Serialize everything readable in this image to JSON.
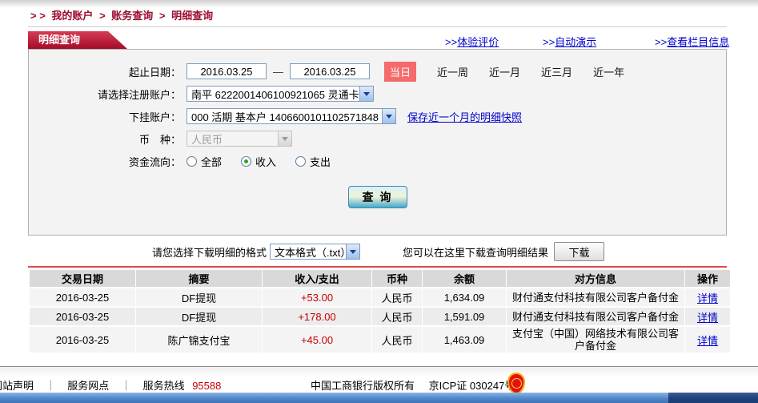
{
  "breadcrumb": {
    "prefix": "> >",
    "separator": ">",
    "items": [
      "我的账户",
      "账务查询",
      "明细查询"
    ]
  },
  "tab": {
    "title": "明细查询"
  },
  "quick_links": [
    {
      "prefix": ">>",
      "label": "体验评价"
    },
    {
      "prefix": ">>",
      "label": "自动演示"
    },
    {
      "prefix": ">>",
      "label": "查看栏目信息"
    }
  ],
  "form": {
    "date_range": {
      "label": "起止日期：",
      "from": "2016.03.25",
      "to": "2016.03.25",
      "separator": "—",
      "presets": [
        {
          "label": "当日",
          "active": true
        },
        {
          "label": "近一周",
          "active": false
        },
        {
          "label": "近一月",
          "active": false
        },
        {
          "label": "近三月",
          "active": false
        },
        {
          "label": "近一年",
          "active": false
        }
      ]
    },
    "register_account": {
      "label": "请选择注册账户：",
      "value": "南平 6222001406100921065 灵通卡"
    },
    "sub_account": {
      "label": "下挂账户：",
      "value": "000 活期 基本户 1406600101102571848",
      "snapshot_link": "保存近一个月的明细快照"
    },
    "currency": {
      "label": "币　种：",
      "value": "人民币",
      "disabled": true
    },
    "fund_flow": {
      "label": "资金流向：",
      "options": [
        {
          "label": "全部",
          "checked": false
        },
        {
          "label": "收入",
          "checked": true
        },
        {
          "label": "支出",
          "checked": false
        }
      ]
    },
    "query_button": "查 询"
  },
  "download": {
    "format_label": "请您选择下载明细的格式",
    "format_value": "文本格式（.txt）",
    "hint": "您可以在这里下载查询明细结果",
    "button": "下载"
  },
  "table": {
    "headers": [
      "交易日期",
      "摘要",
      "收入/支出",
      "币种",
      "余额",
      "对方信息",
      "操作"
    ],
    "rows": [
      {
        "date": "2016-03-25",
        "summary": "DF提现",
        "amount": "+53.00",
        "currency": "人民币",
        "balance": "1,634.09",
        "counterparty": "财付通支付科技有限公司客户备付金",
        "action": "详情"
      },
      {
        "date": "2016-03-25",
        "summary": "DF提现",
        "amount": "+178.00",
        "currency": "人民币",
        "balance": "1,591.09",
        "counterparty": "财付通支付科技有限公司客户备付金",
        "action": "详情"
      },
      {
        "date": "2016-03-25",
        "summary": "陈广锦支付宝",
        "amount": "+45.00",
        "currency": "人民币",
        "balance": "1,463.09",
        "counterparty": "支付宝（中国）网络技术有限公司客户备付金",
        "action": "详情"
      }
    ]
  },
  "footer": {
    "link1": "网站声明",
    "link2": "服务网点",
    "hotline_label": "服务热线",
    "hotline_number": "95588",
    "copyright": "中国工商银行版权所有",
    "icp": "京ICP证 030247号",
    "separator": "｜"
  },
  "colors": {
    "accent_red": "#a30d26",
    "preset_active_bg": "#f56a6a",
    "link_blue": "#0000cc",
    "amount_red": "#cc0000",
    "rule_red": "#e04848",
    "footer_bar_blue": "#4e87c9",
    "footer_bar_dark": "#1d3f77"
  }
}
